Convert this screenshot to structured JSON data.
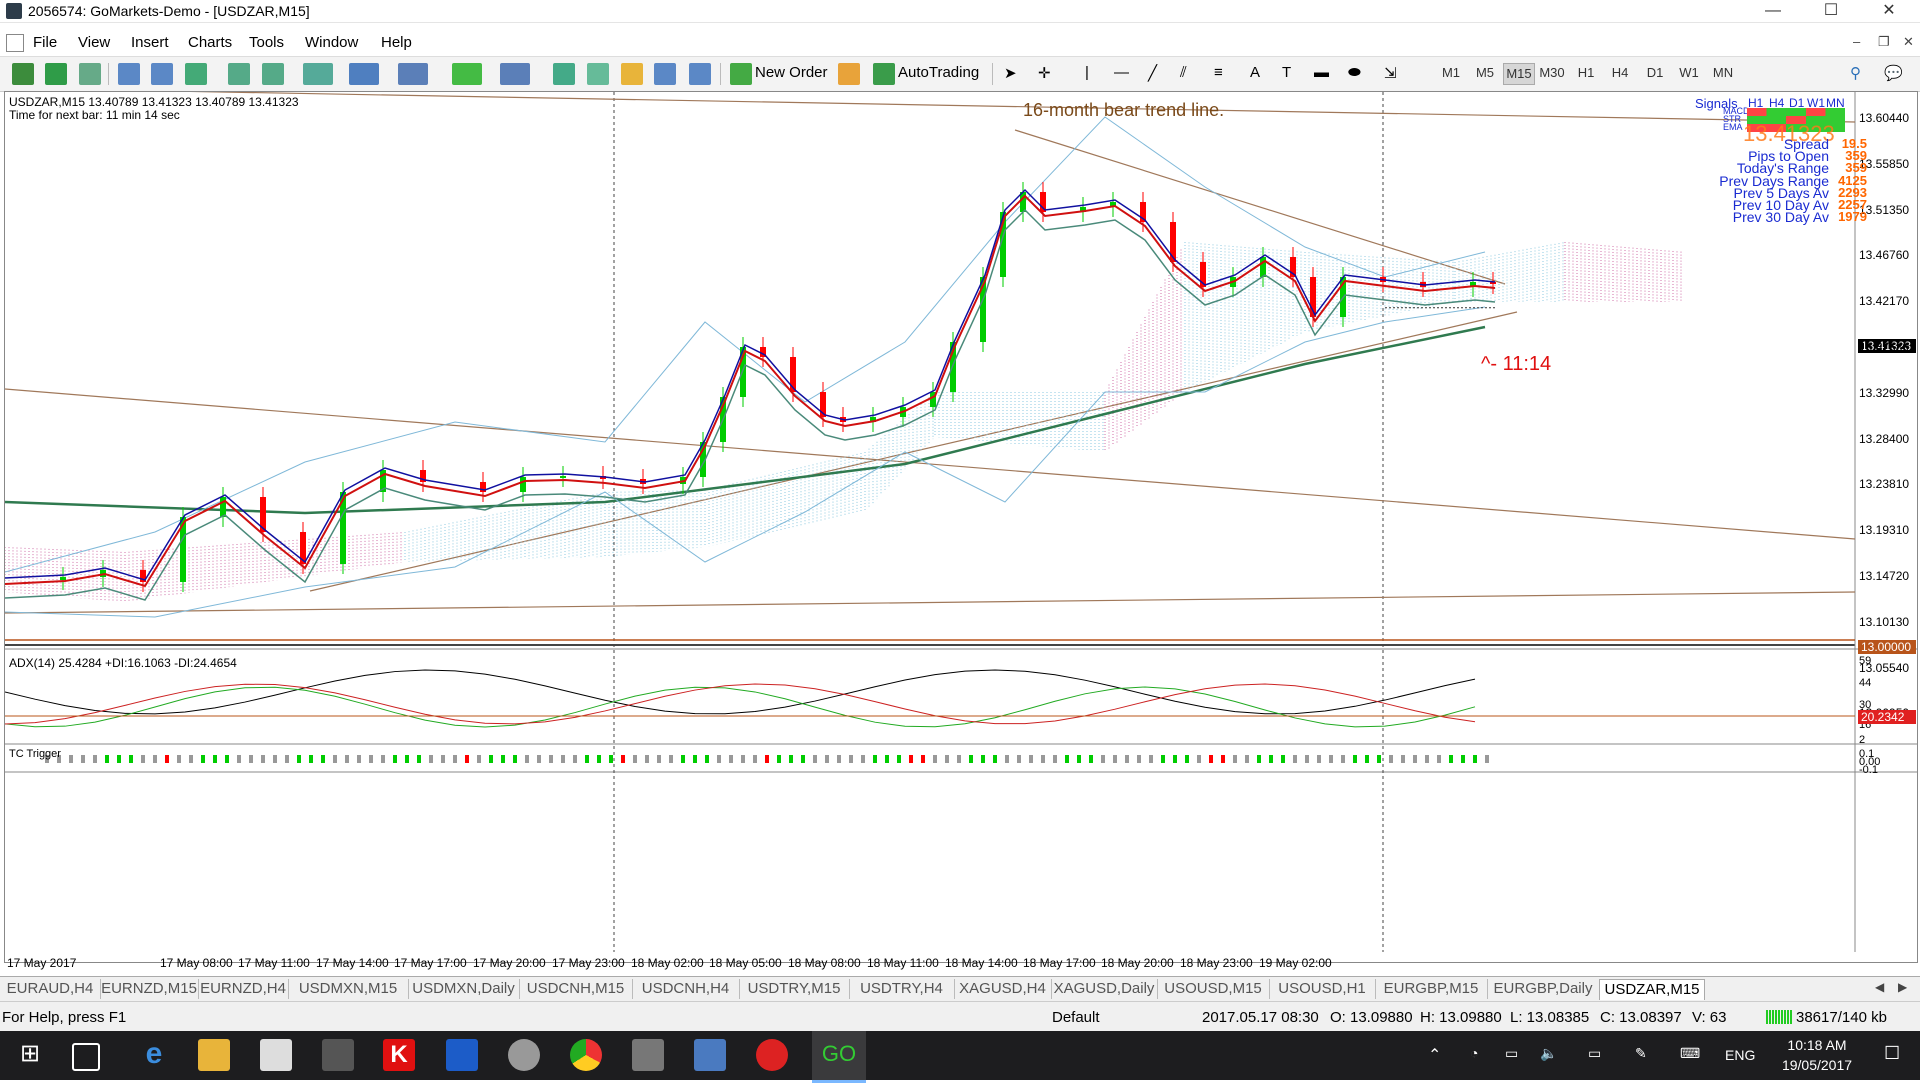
{
  "window": {
    "title": "2056574: GoMarkets-Demo - [USDZAR,M15]",
    "minimize": "—",
    "maximize": "☐",
    "close": "✕"
  },
  "menu": [
    "File",
    "View",
    "Insert",
    "Charts",
    "Tools",
    "Window",
    "Help"
  ],
  "toolbar": {
    "new_order": "New Order",
    "autotrading": "AutoTrading",
    "timeframes": [
      "M1",
      "M5",
      "M15",
      "M30",
      "H1",
      "H4",
      "D1",
      "W1",
      "MN"
    ],
    "active_timeframe": "M15"
  },
  "chart": {
    "header": "USDZAR,M15  13.40789 13.41323 13.40789 13.41323",
    "next_bar": "Time for next bar: 11 min 14 sec",
    "annotation": "16-month bear trend line.",
    "countdown": "^- 11:14",
    "current_price": "13.41323",
    "level_label": "13.00000",
    "price_axis": [
      "13.60440",
      "13.55850",
      "13.51350",
      "13.46760",
      "13.42170",
      "13.37580",
      "13.32990",
      "13.28400",
      "13.23810",
      "13.19310",
      "13.14720",
      "13.10130",
      "13.05540",
      "13.00950"
    ],
    "time_axis": [
      "17 May 2017",
      "17 May 08:00",
      "17 May 11:00",
      "17 May 14:00",
      "17 May 17:00",
      "17 May 20:00",
      "17 May 23:00",
      "18 May 02:00",
      "18 May 05:00",
      "18 May 08:00",
      "18 May 11:00",
      "18 May 14:00",
      "18 May 17:00",
      "18 May 20:00",
      "18 May 23:00",
      "19 May 02:00"
    ],
    "colors": {
      "bull": "#00cc00",
      "bear": "#ff0000",
      "trend": "#a0785a",
      "ma_long": "#2f7a4f",
      "cloud_bull": "#8ec9e0",
      "cloud_bear": "#d070a8"
    }
  },
  "info_panel": {
    "signals": "Signals",
    "tfs": [
      "H1",
      "H4",
      "D1",
      "W1",
      "MN"
    ],
    "rows": [
      "MACD",
      "STR",
      "EMA"
    ],
    "price": "13.41323",
    "stats": [
      {
        "label": "Spread",
        "value": "19.5"
      },
      {
        "label": "Pips to Open",
        "value": "359"
      },
      {
        "label": "Today's Range",
        "value": "359"
      },
      {
        "label": "Prev Days Range",
        "value": "4125"
      },
      {
        "label": "Prev 5 Days Av",
        "value": "2293"
      },
      {
        "label": "Prev 10 Day Av",
        "value": "2257"
      },
      {
        "label": "Prev 30 Day Av",
        "value": "1979"
      }
    ]
  },
  "adx": {
    "label": "ADX(14) 25.4284 +DI:16.1063 -DI:24.4654",
    "axis": [
      "59",
      "44",
      "30",
      "16",
      "2"
    ],
    "current": "20.2342"
  },
  "tc": {
    "label": "TC Trigger",
    "axis": [
      "0.1",
      "0.00",
      "-0.1"
    ]
  },
  "tabs": [
    "EURAUD,H4",
    "EURNZD,M15",
    "EURNZD,H4",
    "USDMXN,M15",
    "USDMXN,Daily",
    "USDCNH,M15",
    "USDCNH,H4",
    "USDTRY,M15",
    "USDTRY,H4",
    "XAGUSD,H4",
    "XAGUSD,Daily",
    "USOUSD,M15",
    "USOUSD,H1",
    "EURGBP,M15",
    "EURGBP,Daily",
    "USDZAR,M15"
  ],
  "status": {
    "help": "For Help, press F1",
    "profile": "Default",
    "datetime": "2017.05.17 08:30",
    "open": "O: 13.09880",
    "high": "H: 13.09880",
    "low": "L: 13.08385",
    "close": "C: 13.08397",
    "volume": "V: 63",
    "traffic": "38617/140 kb"
  },
  "taskbar": {
    "lang": "ENG",
    "time": "10:18 AM",
    "date": "19/05/2017"
  }
}
